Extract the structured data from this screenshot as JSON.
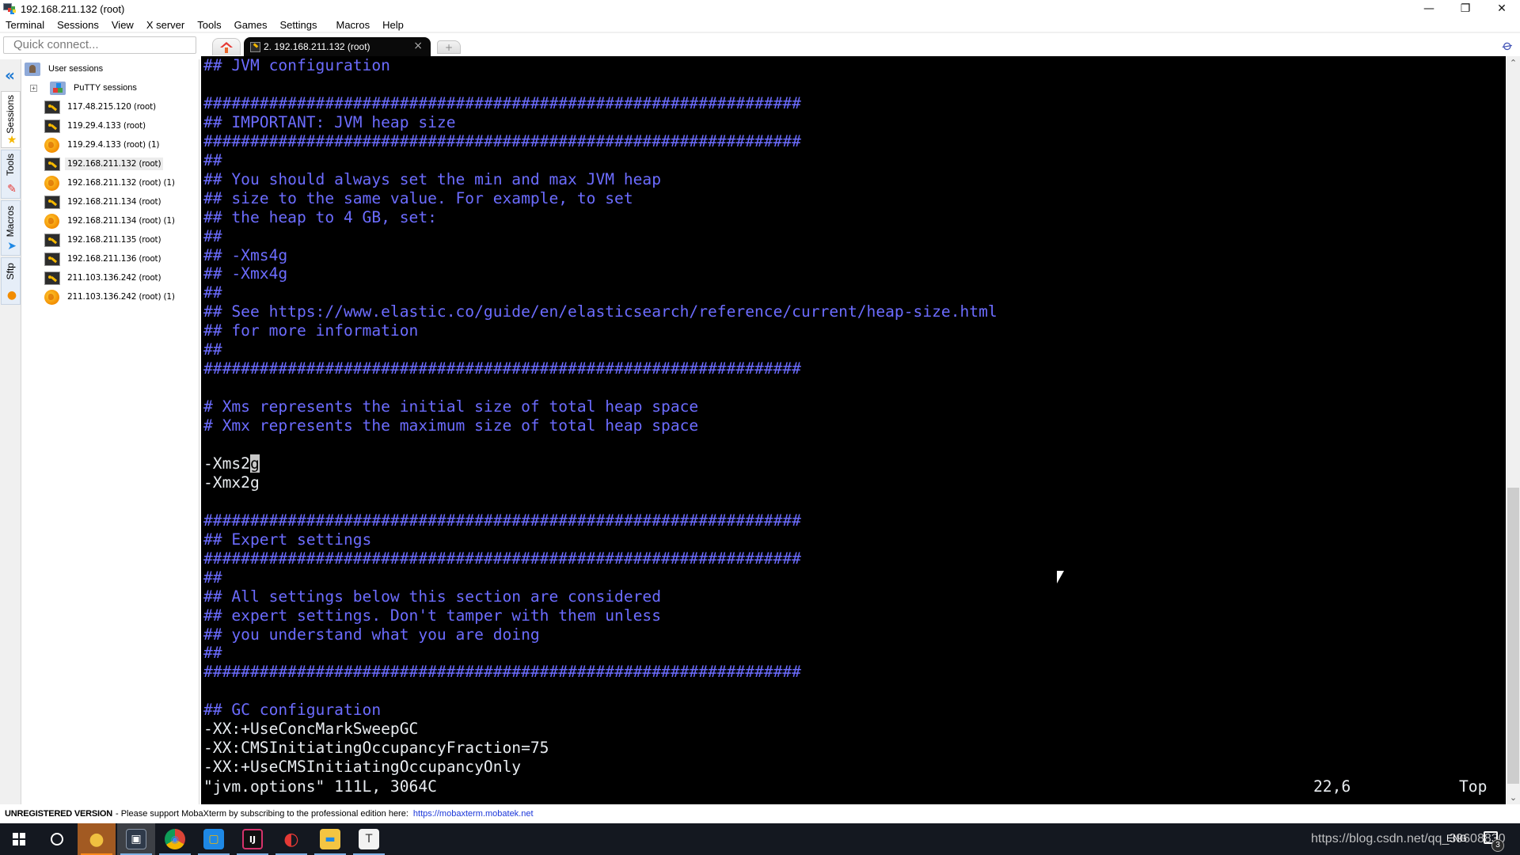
{
  "window": {
    "title": "192.168.211.132 (root)",
    "controls": {
      "minimize": "—",
      "restore": "❐",
      "close": "✕"
    }
  },
  "menu": [
    "Terminal",
    "Sessions",
    "View",
    "X server",
    "Tools",
    "Games",
    "Settings",
    "Macros",
    "Help"
  ],
  "quick_connect": {
    "placeholder": "Quick connect..."
  },
  "tabs": {
    "home_icon": "home-icon",
    "active": {
      "label": "2. 192.168.211.132 (root)",
      "close": "×"
    },
    "new_tab": "+"
  },
  "toolstrip": {
    "tabs": [
      {
        "label": "Sessions",
        "icon": "star-icon",
        "glyph": "★"
      },
      {
        "label": "Tools",
        "icon": "knife-icon",
        "glyph": "✎"
      },
      {
        "label": "Macros",
        "icon": "paper-plane-icon",
        "glyph": "➤"
      },
      {
        "label": "Sftp",
        "icon": "globe-icon",
        "glyph": "●"
      }
    ]
  },
  "session_tree": {
    "root": "User sessions",
    "group": {
      "label": "PuTTY sessions",
      "expand": "+"
    },
    "items": [
      {
        "label": "117.48.215.120 (root)",
        "type": "ssh"
      },
      {
        "label": "119.29.4.133 (root)",
        "type": "ssh"
      },
      {
        "label": "119.29.4.133 (root) (1)",
        "type": "sftp"
      },
      {
        "label": "192.168.211.132 (root)",
        "type": "ssh",
        "selected": true
      },
      {
        "label": "192.168.211.132 (root) (1)",
        "type": "sftp"
      },
      {
        "label": "192.168.211.134 (root)",
        "type": "ssh"
      },
      {
        "label": "192.168.211.134 (root) (1)",
        "type": "sftp"
      },
      {
        "label": "192.168.211.135 (root)",
        "type": "ssh"
      },
      {
        "label": "192.168.211.136 (root)",
        "type": "ssh"
      },
      {
        "label": "211.103.136.242 (root)",
        "type": "ssh"
      },
      {
        "label": "211.103.136.242 (root) (1)",
        "type": "sftp"
      }
    ]
  },
  "terminal": {
    "lines": [
      {
        "text": "## JVM configuration",
        "kind": "comment"
      },
      {
        "text": "",
        "kind": "text"
      },
      {
        "text": "################################################################",
        "kind": "comment"
      },
      {
        "text": "## IMPORTANT: JVM heap size",
        "kind": "comment"
      },
      {
        "text": "################################################################",
        "kind": "comment"
      },
      {
        "text": "##",
        "kind": "comment"
      },
      {
        "text": "## You should always set the min and max JVM heap",
        "kind": "comment"
      },
      {
        "text": "## size to the same value. For example, to set",
        "kind": "comment"
      },
      {
        "text": "## the heap to 4 GB, set:",
        "kind": "comment"
      },
      {
        "text": "##",
        "kind": "comment"
      },
      {
        "text": "## -Xms4g",
        "kind": "comment"
      },
      {
        "text": "## -Xmx4g",
        "kind": "comment"
      },
      {
        "text": "##",
        "kind": "comment"
      },
      {
        "text": "## See https://www.elastic.co/guide/en/elasticsearch/reference/current/heap-size.html",
        "kind": "comment"
      },
      {
        "text": "## for more information",
        "kind": "comment"
      },
      {
        "text": "##",
        "kind": "comment"
      },
      {
        "text": "################################################################",
        "kind": "comment"
      },
      {
        "text": "",
        "kind": "text"
      },
      {
        "text": "# Xms represents the initial size of total heap space",
        "kind": "comment"
      },
      {
        "text": "# Xmx represents the maximum size of total heap space",
        "kind": "comment"
      },
      {
        "text": "",
        "kind": "text"
      },
      {
        "text": "-Xms2g",
        "kind": "text",
        "cursor_after": "g",
        "before": "-Xms2"
      },
      {
        "text": "-Xmx2g",
        "kind": "text"
      },
      {
        "text": "",
        "kind": "text"
      },
      {
        "text": "################################################################",
        "kind": "comment"
      },
      {
        "text": "## Expert settings",
        "kind": "comment"
      },
      {
        "text": "################################################################",
        "kind": "comment"
      },
      {
        "text": "##",
        "kind": "comment"
      },
      {
        "text": "## All settings below this section are considered",
        "kind": "comment"
      },
      {
        "text": "## expert settings. Don't tamper with them unless",
        "kind": "comment"
      },
      {
        "text": "## you understand what you are doing",
        "kind": "comment"
      },
      {
        "text": "##",
        "kind": "comment"
      },
      {
        "text": "################################################################",
        "kind": "comment"
      },
      {
        "text": "",
        "kind": "text"
      },
      {
        "text": "## GC configuration",
        "kind": "comment"
      },
      {
        "text": "-XX:+UseConcMarkSweepGC",
        "kind": "text"
      },
      {
        "text": "-XX:CMSInitiatingOccupancyFraction=75",
        "kind": "text"
      },
      {
        "text": "-XX:+UseCMSInitiatingOccupancyOnly",
        "kind": "text"
      }
    ],
    "status_line": "\"jvm.options\" 111L, 3064C",
    "cursor_position": "22,6",
    "scroll_position": "Top",
    "colors": {
      "comment": "#6c6cff",
      "text": "#e8ecf0",
      "background": "#000000"
    }
  },
  "scrollbar": {
    "up": "⌃",
    "down": "⌄",
    "thumb_position_fraction": 0.58,
    "thumb_size_fraction": 0.41
  },
  "statusbar": {
    "unregistered": "UNREGISTERED VERSION",
    "support_text": "-  Please support MobaXterm by subscribing to the professional edition here:",
    "link": "https://mobaxterm.mobatek.net"
  },
  "taskbar": {
    "apps": [
      {
        "name": "start",
        "icon": "windows-icon"
      },
      {
        "name": "search",
        "icon": "cortana-icon"
      },
      {
        "name": "navicat",
        "icon": "navicat-icon",
        "glyph": "●",
        "color": "#f0c040"
      },
      {
        "name": "mobaxterm",
        "icon": "mobaxterm-icon",
        "glyph": "▣",
        "color": "#2f3a4a"
      },
      {
        "name": "chrome",
        "icon": "chrome-icon",
        "glyph": "◉",
        "color": "#db4437"
      },
      {
        "name": "vmware",
        "icon": "vmware-icon",
        "glyph": "▢",
        "color": "#1e88e5"
      },
      {
        "name": "intellij",
        "icon": "intellij-icon",
        "glyph": "IJ",
        "color": "#1a1a1a"
      },
      {
        "name": "xshell",
        "icon": "xshell-icon",
        "glyph": "◐",
        "color": "#1565c0"
      },
      {
        "name": "file-explorer",
        "icon": "folder-icon",
        "glyph": "▬",
        "color": "#f4c542"
      },
      {
        "name": "typora",
        "icon": "typora-icon",
        "glyph": "T",
        "color": "#f2f2f2"
      }
    ],
    "tray": {
      "watermark": "https://blog.csdn.net/qq_39608830",
      "language": "ENG",
      "notifications": "3"
    }
  }
}
